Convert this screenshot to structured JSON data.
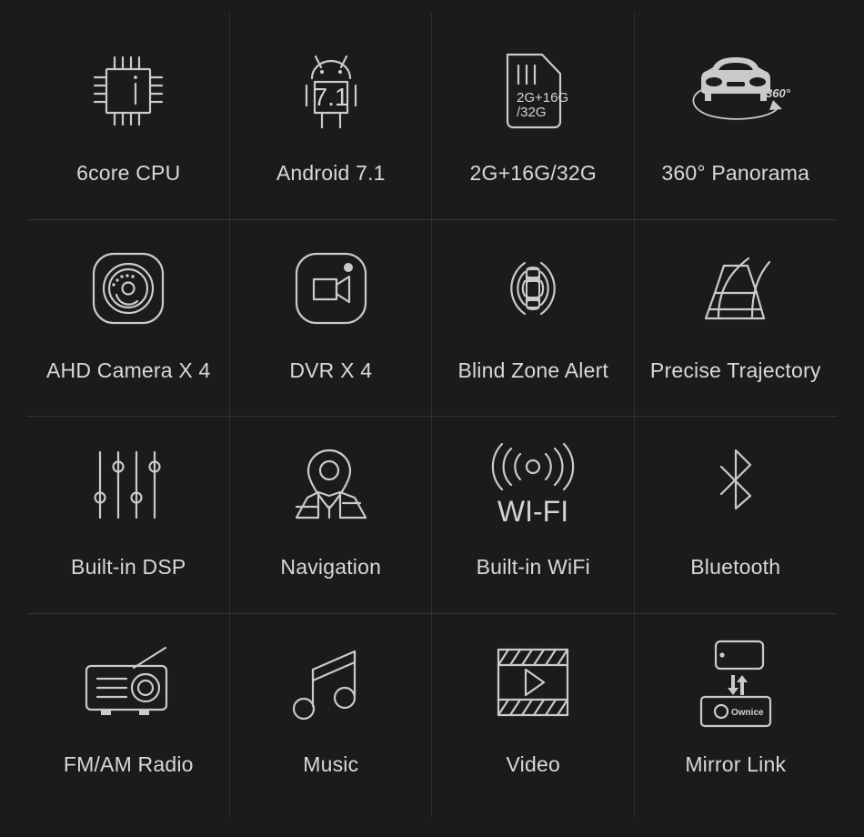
{
  "page": {
    "title": "Car Head Unit Feature Grid",
    "background_color": "#1a1b1d",
    "text_color": "#d7d8d9",
    "icon_color": "#c9cacb",
    "divider_color": "#343537",
    "columns": 4,
    "rows": 4
  },
  "features": [
    {
      "id": "6core-cpu",
      "icon": "cpu-chip-icon",
      "label": "6core CPU"
    },
    {
      "id": "android-71",
      "icon": "android-robot-icon",
      "label": "Android 7.1",
      "icon_text": "7.1"
    },
    {
      "id": "memory-storage",
      "icon": "sim-card-icon",
      "label": "2G+16G/32G",
      "icon_text_line1": "2G+16G",
      "icon_text_line2": "/32G"
    },
    {
      "id": "360-panorama",
      "icon": "car-360-panorama-icon",
      "label": "360° Panorama",
      "icon_text": "360°"
    },
    {
      "id": "ahd-camera-x4",
      "icon": "camera-lens-icon",
      "label": "AHD Camera X 4"
    },
    {
      "id": "dvr-x4",
      "icon": "video-camera-icon",
      "label": "DVR X 4"
    },
    {
      "id": "blind-zone-alert",
      "icon": "blind-zone-radar-icon",
      "label": "Blind Zone Alert"
    },
    {
      "id": "precise-trajectory",
      "icon": "parking-trajectory-icon",
      "label": "Precise Trajectory"
    },
    {
      "id": "built-in-dsp",
      "icon": "equalizer-sliders-icon",
      "label": "Built-in DSP"
    },
    {
      "id": "navigation",
      "icon": "map-pin-icon",
      "label": "Navigation"
    },
    {
      "id": "built-in-wifi",
      "icon": "wifi-signal-icon",
      "label": "Built-in WiFi",
      "icon_text": "WI-FI"
    },
    {
      "id": "bluetooth",
      "icon": "bluetooth-icon",
      "label": "Bluetooth"
    },
    {
      "id": "fm-am-radio",
      "icon": "radio-icon",
      "label": "FM/AM Radio"
    },
    {
      "id": "music",
      "icon": "music-note-icon",
      "label": "Music"
    },
    {
      "id": "video",
      "icon": "film-play-icon",
      "label": "Video"
    },
    {
      "id": "mirror-link",
      "icon": "mirror-link-icon",
      "label": "Mirror Link",
      "icon_text": "Ownice"
    }
  ]
}
